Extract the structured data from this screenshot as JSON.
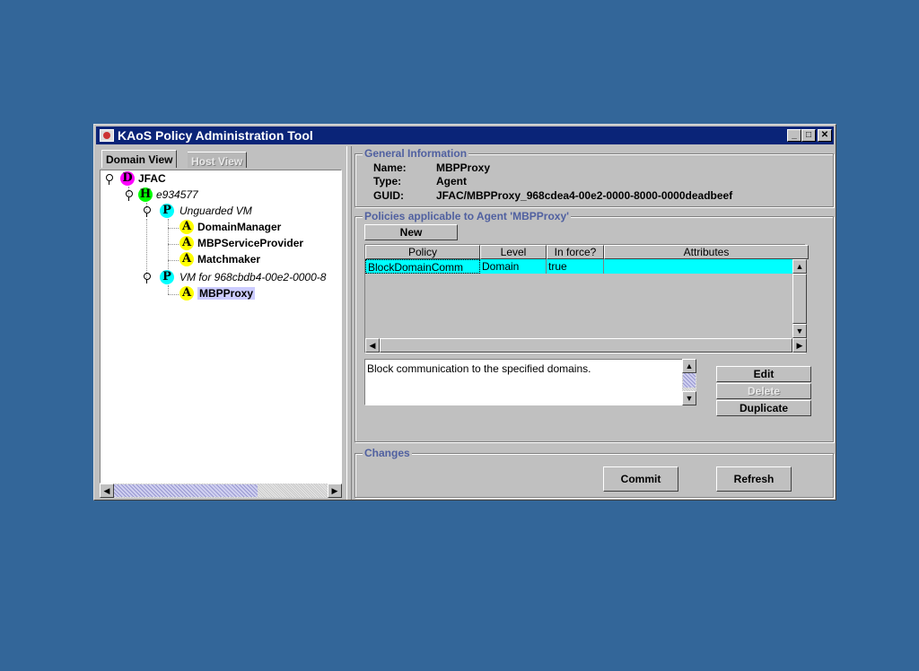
{
  "window": {
    "title": "KAoS Policy Administration Tool"
  },
  "tabs": [
    {
      "label": "Domain View",
      "active": true
    },
    {
      "label": "Host View",
      "active": false
    }
  ],
  "tree": {
    "domain": {
      "badge": "D",
      "label": "JFAC",
      "color": "#ff00ff"
    },
    "host": {
      "badge": "H",
      "label": "e934577",
      "color": "#00ff00"
    },
    "vm1": {
      "badge": "P",
      "label": "Unguarded VM",
      "color": "#00ffff"
    },
    "agents1": [
      {
        "badge": "A",
        "label": "DomainManager"
      },
      {
        "badge": "A",
        "label": "MBPServiceProvider"
      },
      {
        "badge": "A",
        "label": "Matchmaker"
      }
    ],
    "vm2": {
      "badge": "P",
      "label": "VM for 968cbdb4-00e2-0000-8",
      "color": "#00ffff"
    },
    "agents2": [
      {
        "badge": "A",
        "label": "MBPProxy",
        "selected": true
      }
    ],
    "agent_color": "#ffff00",
    "selected_color": "#ccccff"
  },
  "general": {
    "title": "General Information",
    "name_label": "Name:",
    "name_value": "MBPProxy",
    "type_label": "Type:",
    "type_value": "Agent",
    "guid_label": "GUID:",
    "guid_value": "JFAC/MBPProxy_968cdea4-00e2-0000-8000-0000deadbeef"
  },
  "policies": {
    "title": "Policies applicable to Agent 'MBPProxy'",
    "new_label": "New",
    "columns": [
      "Policy",
      "Level",
      "In force?",
      "Attributes"
    ],
    "rows": [
      {
        "policy": "BlockDomainComm",
        "level": "Domain",
        "in_force": "true",
        "attributes": ""
      }
    ],
    "description": "Block communication to the specified domains.",
    "edit_label": "Edit",
    "delete_label": "Delete",
    "duplicate_label": "Duplicate",
    "highlight_color": "#00ffff"
  },
  "changes": {
    "title": "Changes",
    "commit_label": "Commit",
    "refresh_label": "Refresh"
  }
}
